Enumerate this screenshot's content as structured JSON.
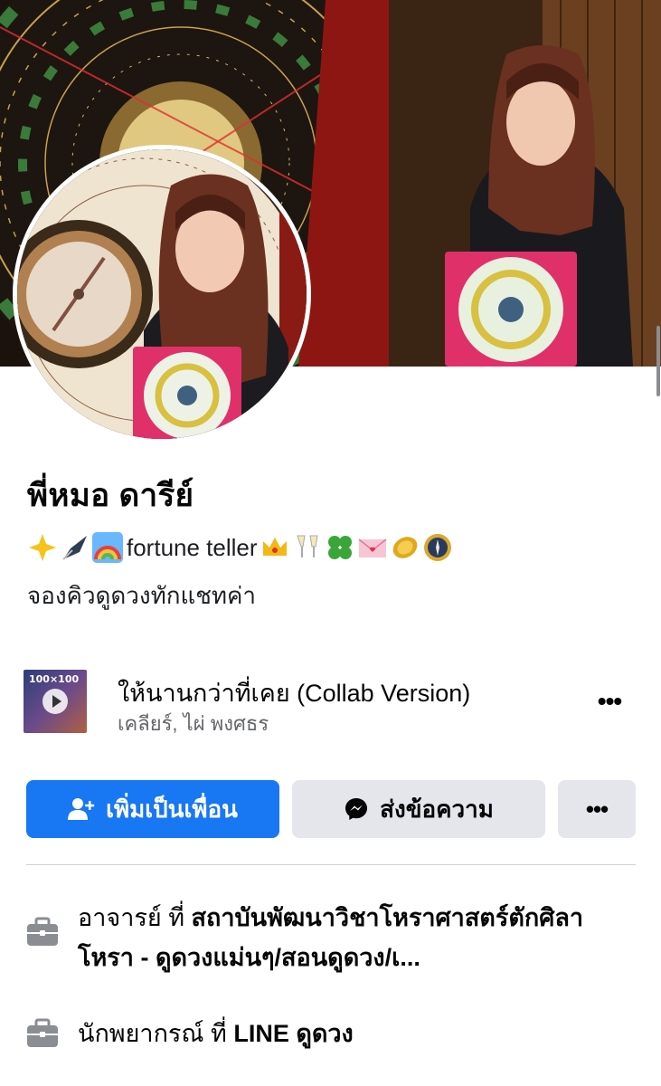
{
  "profile": {
    "name": "พี่หมอ ดารีย์",
    "bio_emoji_before": [
      "sparkle-emoji",
      "pen-nib-emoji",
      "rainbow-emoji"
    ],
    "bio_text": "fortune teller",
    "bio_emoji_after": [
      "crown-emoji",
      "champagne-emoji",
      "clover-emoji",
      "love-letter-emoji",
      "coin-emoji",
      "compass-emoji"
    ],
    "bio_line2": "จองคิวดูดวงทักแชทค่า"
  },
  "music": {
    "cover_tag": "100×100",
    "title": "ให้นานกว่าที่เคย (Collab Version)",
    "artist": "เคลียร์, ไผ่ พงศธร",
    "more_label": "•••"
  },
  "actions": {
    "add_friend_label": "เพิ่มเป็นเพื่อน",
    "message_label": "ส่งข้อความ",
    "more_label": "•••",
    "add_friend_color": "#1877f2",
    "secondary_color": "#e4e6eb"
  },
  "details": [
    {
      "icon": "briefcase-icon",
      "role": "อาจารย์",
      "connector": "ที่",
      "place": "สถาบันพัฒนาวิชาโหราศาสตร์ตักศิลาโหรา - ดูดวงแม่นๆ/สอนดูดวง/เ..."
    },
    {
      "icon": "briefcase-icon",
      "role": "นักพยากรณ์",
      "connector": "ที่",
      "place": "LINE ดูดวง"
    }
  ]
}
